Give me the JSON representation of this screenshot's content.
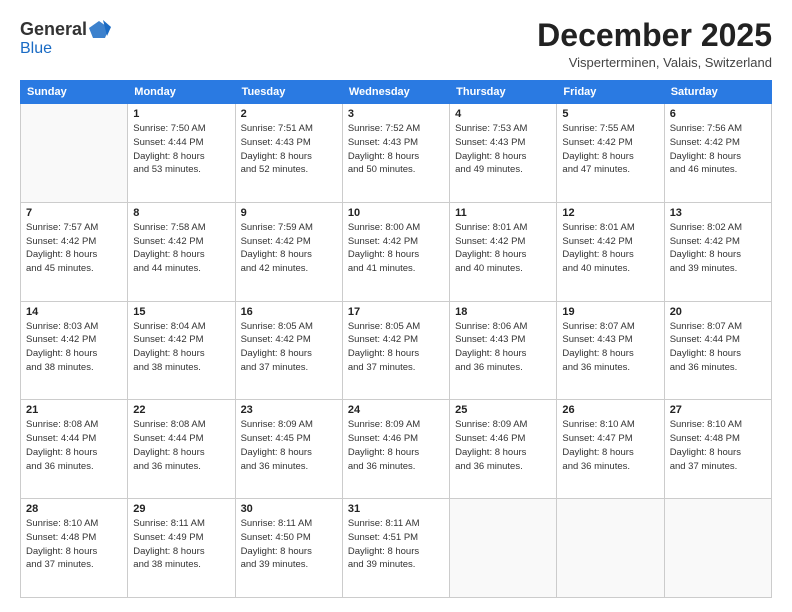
{
  "header": {
    "logo_general": "General",
    "logo_blue": "Blue",
    "month": "December 2025",
    "location": "Visperterminen, Valais, Switzerland"
  },
  "days_of_week": [
    "Sunday",
    "Monday",
    "Tuesday",
    "Wednesday",
    "Thursday",
    "Friday",
    "Saturday"
  ],
  "weeks": [
    [
      {
        "day": "",
        "info": ""
      },
      {
        "day": "1",
        "info": "Sunrise: 7:50 AM\nSunset: 4:44 PM\nDaylight: 8 hours\nand 53 minutes."
      },
      {
        "day": "2",
        "info": "Sunrise: 7:51 AM\nSunset: 4:43 PM\nDaylight: 8 hours\nand 52 minutes."
      },
      {
        "day": "3",
        "info": "Sunrise: 7:52 AM\nSunset: 4:43 PM\nDaylight: 8 hours\nand 50 minutes."
      },
      {
        "day": "4",
        "info": "Sunrise: 7:53 AM\nSunset: 4:43 PM\nDaylight: 8 hours\nand 49 minutes."
      },
      {
        "day": "5",
        "info": "Sunrise: 7:55 AM\nSunset: 4:42 PM\nDaylight: 8 hours\nand 47 minutes."
      },
      {
        "day": "6",
        "info": "Sunrise: 7:56 AM\nSunset: 4:42 PM\nDaylight: 8 hours\nand 46 minutes."
      }
    ],
    [
      {
        "day": "7",
        "info": "Sunrise: 7:57 AM\nSunset: 4:42 PM\nDaylight: 8 hours\nand 45 minutes."
      },
      {
        "day": "8",
        "info": "Sunrise: 7:58 AM\nSunset: 4:42 PM\nDaylight: 8 hours\nand 44 minutes."
      },
      {
        "day": "9",
        "info": "Sunrise: 7:59 AM\nSunset: 4:42 PM\nDaylight: 8 hours\nand 42 minutes."
      },
      {
        "day": "10",
        "info": "Sunrise: 8:00 AM\nSunset: 4:42 PM\nDaylight: 8 hours\nand 41 minutes."
      },
      {
        "day": "11",
        "info": "Sunrise: 8:01 AM\nSunset: 4:42 PM\nDaylight: 8 hours\nand 40 minutes."
      },
      {
        "day": "12",
        "info": "Sunrise: 8:01 AM\nSunset: 4:42 PM\nDaylight: 8 hours\nand 40 minutes."
      },
      {
        "day": "13",
        "info": "Sunrise: 8:02 AM\nSunset: 4:42 PM\nDaylight: 8 hours\nand 39 minutes."
      }
    ],
    [
      {
        "day": "14",
        "info": "Sunrise: 8:03 AM\nSunset: 4:42 PM\nDaylight: 8 hours\nand 38 minutes."
      },
      {
        "day": "15",
        "info": "Sunrise: 8:04 AM\nSunset: 4:42 PM\nDaylight: 8 hours\nand 38 minutes."
      },
      {
        "day": "16",
        "info": "Sunrise: 8:05 AM\nSunset: 4:42 PM\nDaylight: 8 hours\nand 37 minutes."
      },
      {
        "day": "17",
        "info": "Sunrise: 8:05 AM\nSunset: 4:42 PM\nDaylight: 8 hours\nand 37 minutes."
      },
      {
        "day": "18",
        "info": "Sunrise: 8:06 AM\nSunset: 4:43 PM\nDaylight: 8 hours\nand 36 minutes."
      },
      {
        "day": "19",
        "info": "Sunrise: 8:07 AM\nSunset: 4:43 PM\nDaylight: 8 hours\nand 36 minutes."
      },
      {
        "day": "20",
        "info": "Sunrise: 8:07 AM\nSunset: 4:44 PM\nDaylight: 8 hours\nand 36 minutes."
      }
    ],
    [
      {
        "day": "21",
        "info": "Sunrise: 8:08 AM\nSunset: 4:44 PM\nDaylight: 8 hours\nand 36 minutes."
      },
      {
        "day": "22",
        "info": "Sunrise: 8:08 AM\nSunset: 4:44 PM\nDaylight: 8 hours\nand 36 minutes."
      },
      {
        "day": "23",
        "info": "Sunrise: 8:09 AM\nSunset: 4:45 PM\nDaylight: 8 hours\nand 36 minutes."
      },
      {
        "day": "24",
        "info": "Sunrise: 8:09 AM\nSunset: 4:46 PM\nDaylight: 8 hours\nand 36 minutes."
      },
      {
        "day": "25",
        "info": "Sunrise: 8:09 AM\nSunset: 4:46 PM\nDaylight: 8 hours\nand 36 minutes."
      },
      {
        "day": "26",
        "info": "Sunrise: 8:10 AM\nSunset: 4:47 PM\nDaylight: 8 hours\nand 36 minutes."
      },
      {
        "day": "27",
        "info": "Sunrise: 8:10 AM\nSunset: 4:48 PM\nDaylight: 8 hours\nand 37 minutes."
      }
    ],
    [
      {
        "day": "28",
        "info": "Sunrise: 8:10 AM\nSunset: 4:48 PM\nDaylight: 8 hours\nand 37 minutes."
      },
      {
        "day": "29",
        "info": "Sunrise: 8:11 AM\nSunset: 4:49 PM\nDaylight: 8 hours\nand 38 minutes."
      },
      {
        "day": "30",
        "info": "Sunrise: 8:11 AM\nSunset: 4:50 PM\nDaylight: 8 hours\nand 39 minutes."
      },
      {
        "day": "31",
        "info": "Sunrise: 8:11 AM\nSunset: 4:51 PM\nDaylight: 8 hours\nand 39 minutes."
      },
      {
        "day": "",
        "info": ""
      },
      {
        "day": "",
        "info": ""
      },
      {
        "day": "",
        "info": ""
      }
    ]
  ]
}
